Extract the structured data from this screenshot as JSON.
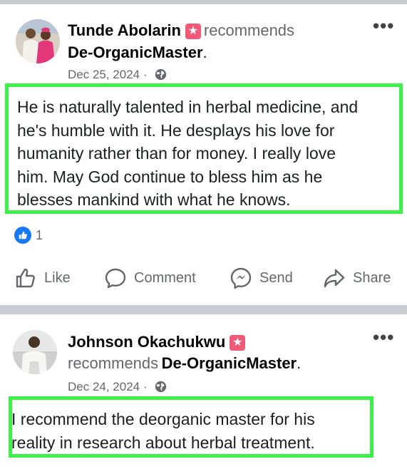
{
  "posts": [
    {
      "author": "Tunde Abolarin",
      "recommends_text": "recommends",
      "page_name": "De-OrganicMaster",
      "date": "Dec 25, 2024",
      "review": [
        "He is naturally talented in herbal medicine, and",
        "he's humble with it. He desplays his love for",
        "humanity rather than for money. I really love",
        "him. May God continue to bless him as he",
        "blesses mankind with what he knows."
      ],
      "like_count": "1"
    },
    {
      "author": "Johnson Okachukwu",
      "recommends_text": "recommends",
      "page_name": "De-OrganicMaster",
      "date": "Dec 24, 2024",
      "review": [
        "I recommend the deorganic master for his",
        "reality in research about herbal treatment."
      ]
    }
  ],
  "actions": {
    "like": "Like",
    "comment": "Comment",
    "send": "Send",
    "share": "Share"
  },
  "icons": {
    "recommend_badge": "recommend-star-icon",
    "more": "more-options-icon",
    "privacy": "globe-icon"
  },
  "colors": {
    "highlight_border": "#3df04a",
    "like_blue": "#1877f2",
    "badge_pink": "#f05a78"
  }
}
